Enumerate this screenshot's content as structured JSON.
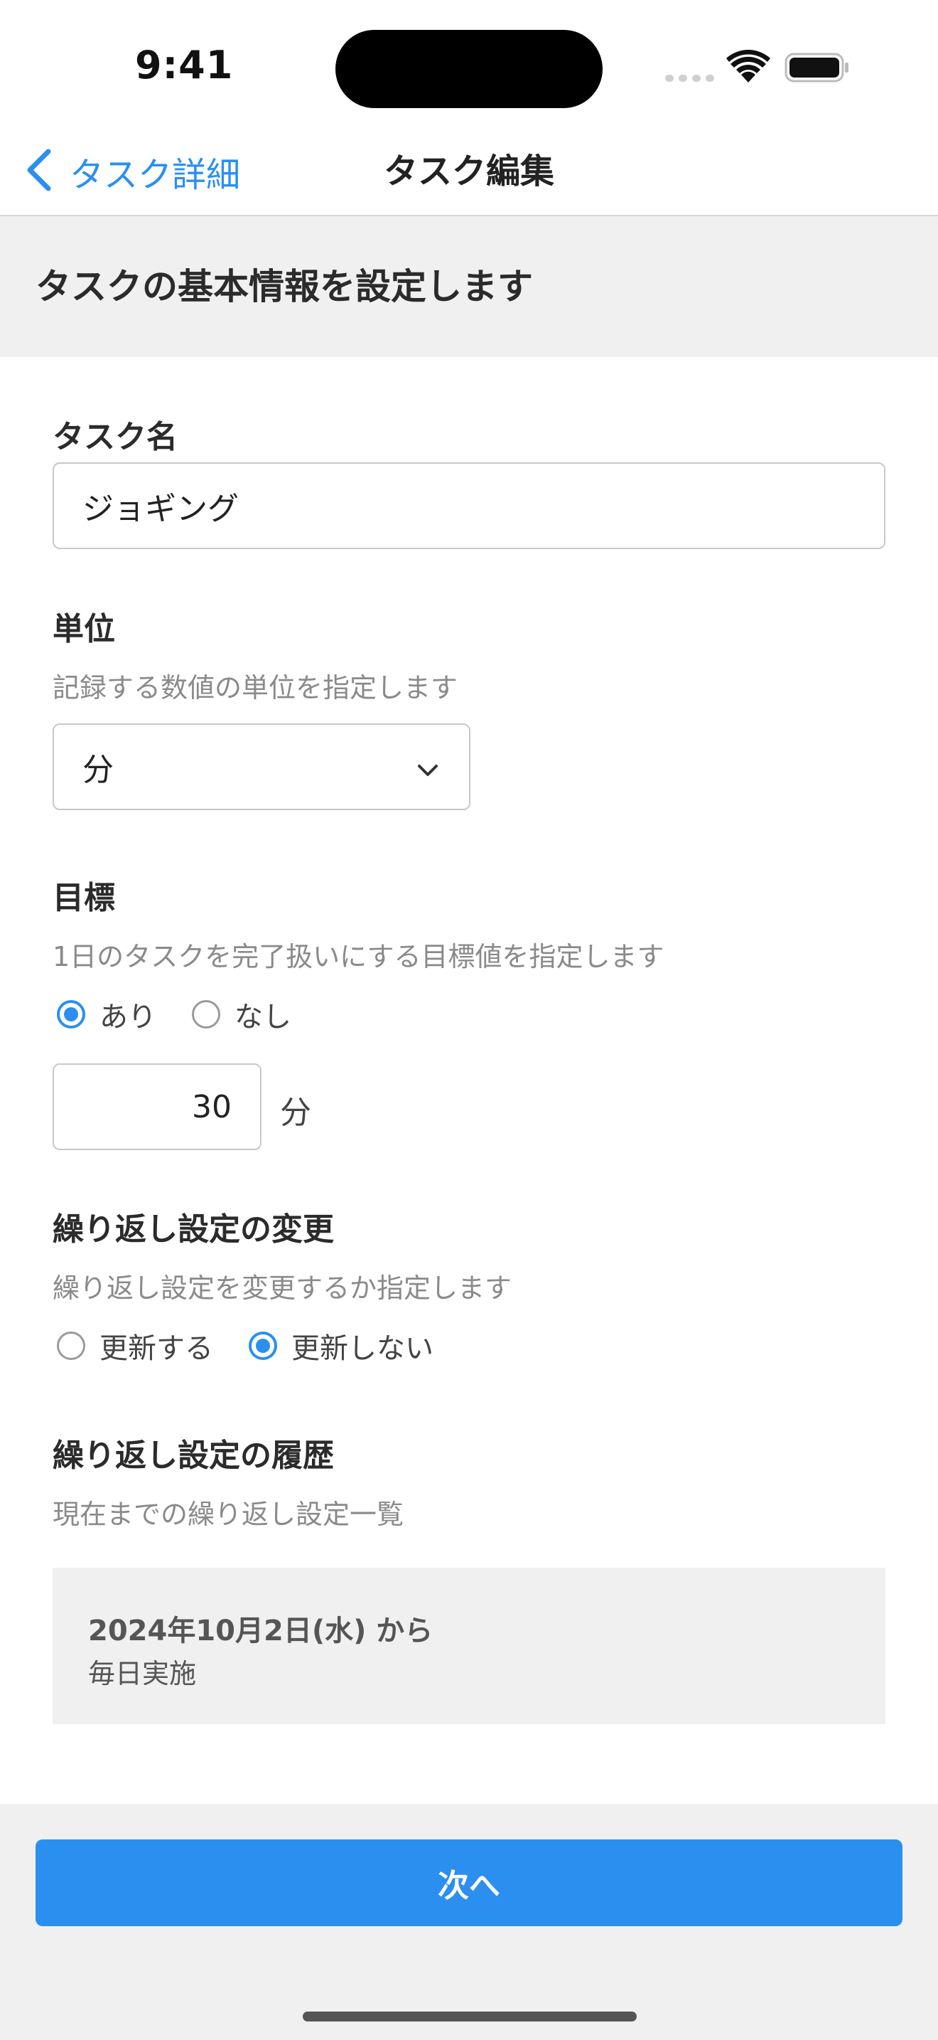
{
  "status_bar": {
    "time": "9:41"
  },
  "nav": {
    "back_label": "タスク詳細",
    "title": "タスク編集"
  },
  "section": {
    "header": "タスクの基本情報を設定します"
  },
  "form": {
    "task_name": {
      "label": "タスク名",
      "value": "ジョギング"
    },
    "unit": {
      "label": "単位",
      "description": "記録する数値の単位を指定します",
      "selected": "分"
    },
    "goal": {
      "label": "目標",
      "description": "1日のタスクを完了扱いにする目標値を指定します",
      "options": [
        {
          "label": "あり",
          "checked": true
        },
        {
          "label": "なし",
          "checked": false
        }
      ],
      "value": "30",
      "unit": "分"
    },
    "repeat_change": {
      "label": "繰り返し設定の変更",
      "description": "繰り返し設定を変更するか指定します",
      "options": [
        {
          "label": "更新する",
          "checked": false
        },
        {
          "label": "更新しない",
          "checked": true
        }
      ]
    },
    "repeat_history": {
      "label": "繰り返し設定の履歴",
      "description": "現在までの繰り返し設定一覧",
      "entries": [
        {
          "date": "2024年10月2日(水) から",
          "rule": "毎日実施"
        }
      ]
    }
  },
  "footer": {
    "next_label": "次へ"
  },
  "colors": {
    "accent": "#2b8ff0",
    "section_background": "#f0f0f0"
  }
}
